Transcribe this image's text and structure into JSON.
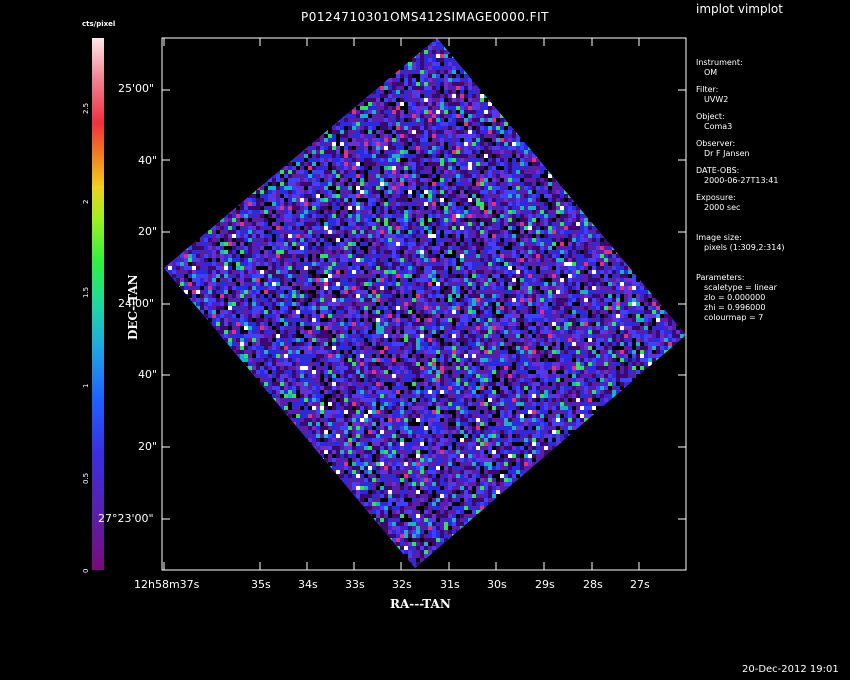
{
  "window": {
    "app_title": "implot vimplot",
    "image_title": "P0124710301OMS412SIMAGE0000.FIT",
    "date_stamp": "20-Dec-2012 19:01"
  },
  "colorbar": {
    "unit": "cts/pixel",
    "ticks": [
      "0",
      "0.5",
      "1",
      "1.5",
      "2",
      "2.5"
    ]
  },
  "axes": {
    "y_label": "DEC--TAN",
    "x_label": "RA---TAN",
    "y_ticks": [
      "25'00\"",
      "40\"",
      "20\"",
      "24'00\"",
      "40\"",
      "20\"",
      "27°23'00\""
    ],
    "x_ticks": [
      "12h58m37s",
      "35s",
      "34s",
      "33s",
      "32s",
      "31s",
      "30s",
      "29s",
      "28s",
      "27s"
    ]
  },
  "info": {
    "instrument_label": "Instrument:",
    "instrument": "OM",
    "filter_label": "Filter:",
    "filter": "UVW2",
    "object_label": "Object:",
    "object": "Coma3",
    "observer_label": "Observer:",
    "observer": "Dr F Jansen",
    "date_obs_label": "DATE-OBS:",
    "date_obs": "2000-06-27T13:41",
    "exposure_label": "Exposure:",
    "exposure": "2000 sec",
    "image_size_label": "Image size:",
    "image_size": "pixels (1:309,2:314)",
    "parameters_label": "Parameters:",
    "scaletype": "scaletype = linear",
    "zlo": "zlo = 0.000000",
    "zhi": "zhi = 0.996000",
    "colourmap": "colourmap =   7"
  },
  "colors": {
    "background": "#000000",
    "frame": "#ffffff",
    "image_palette": [
      "#000000",
      "#3a0a6e",
      "#5a1fa8",
      "#2b2bdc",
      "#4040ff",
      "#6a2fd0",
      "#1ab0c8",
      "#30e060",
      "#e03080",
      "#ffffff"
    ]
  }
}
